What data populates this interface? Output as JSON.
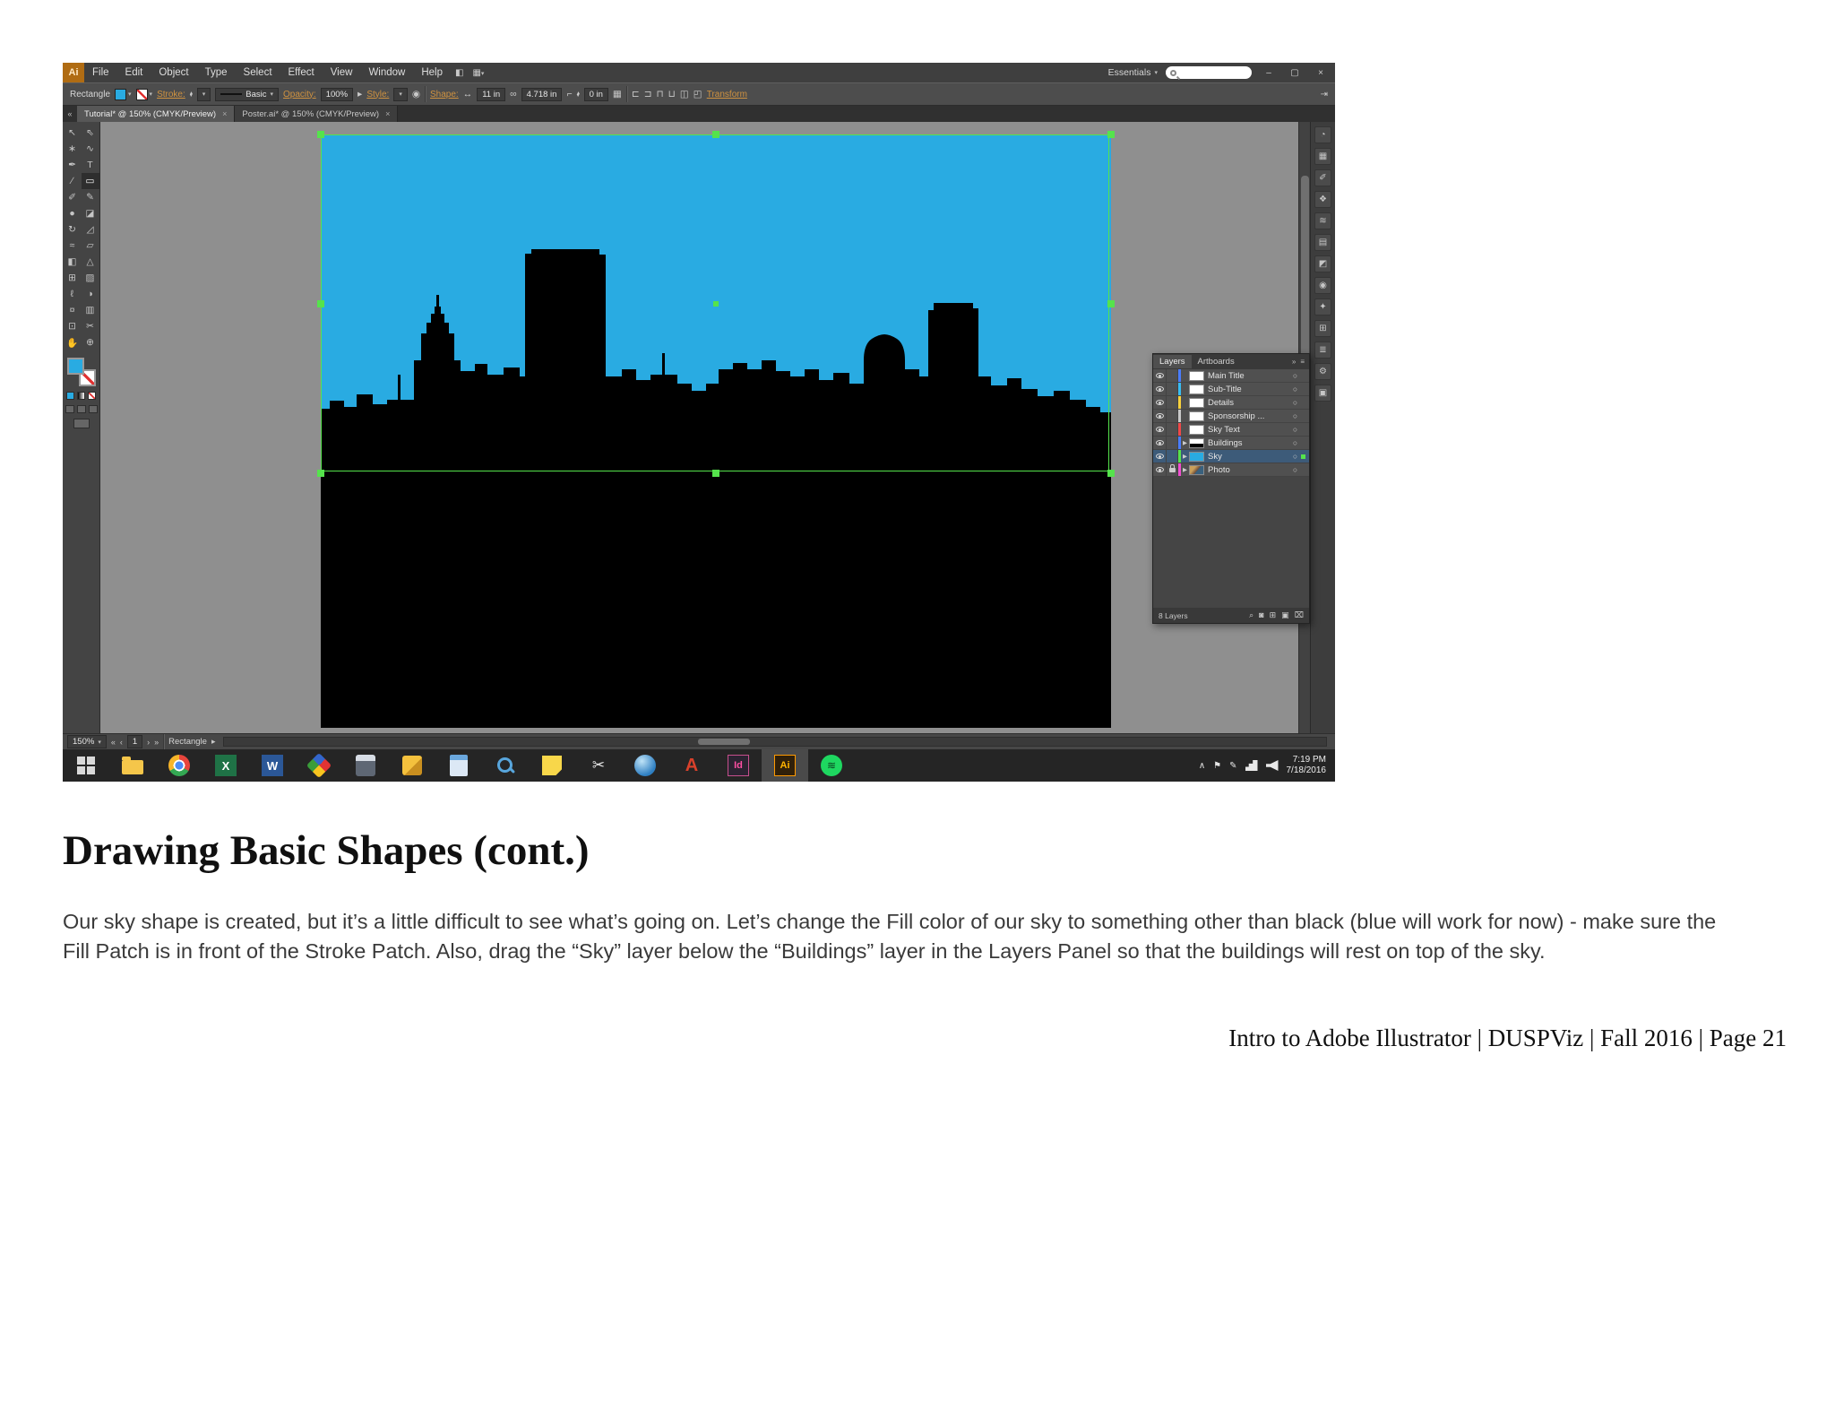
{
  "window": {
    "logo_text": "Ai",
    "menu_items": [
      "File",
      "Edit",
      "Object",
      "Type",
      "Select",
      "Effect",
      "View",
      "Window",
      "Help"
    ],
    "workspace_label": "Essentials"
  },
  "icons": {
    "dropdown": "▾",
    "side_arrow": "▸",
    "expand": "▶",
    "collapse": "«",
    "double_arrow": "»",
    "panel_menu": "≡",
    "close": "×",
    "minimize": "–",
    "restore": "▢",
    "target": "○",
    "width": "↔",
    "height": "↕",
    "corner": "⌐",
    "link_dims": "∞",
    "recolor": "◉",
    "grid": "▦",
    "locate": "⌕",
    "make_mask": "◙",
    "new_sublayer": "⊞",
    "new_layer": "▣",
    "delete": "⌧",
    "nav_first": "«",
    "nav_prev": "‹",
    "nav_next": "›",
    "nav_last": "»",
    "tray_up": "∧",
    "flag": "⚑",
    "pen": "✎",
    "scissors": "✂",
    "spotify_wave": "≋",
    "bridge": "◧",
    "arrange": "▦",
    "align": [
      "⊏",
      "⊐",
      "⊓",
      "⊔",
      "◫",
      "◰"
    ]
  },
  "control_bar": {
    "tool_label": "Rectangle",
    "stroke_label": "Stroke:",
    "brush_name": "Basic",
    "opacity_label": "Opacity:",
    "opacity_value": "100%",
    "style_label": "Style:",
    "shape_label": "Shape:",
    "width_value": "11 in",
    "height_value": "4.718 in",
    "corner_value": "0 in",
    "transform_label": "Transform"
  },
  "tabs": [
    {
      "label": "Tutorial* @ 150% (CMYK/Preview)"
    },
    {
      "label": "Poster.ai* @ 150% (CMYK/Preview)"
    }
  ],
  "tools": [
    {
      "name": "selection-tool",
      "glyph": "↖"
    },
    {
      "name": "direct-selection-tool",
      "glyph": "⇖"
    },
    {
      "name": "magic-wand-tool",
      "glyph": "∗"
    },
    {
      "name": "lasso-tool",
      "glyph": "∿"
    },
    {
      "name": "pen-tool",
      "glyph": "✒"
    },
    {
      "name": "type-tool",
      "glyph": "T"
    },
    {
      "name": "line-tool",
      "glyph": "∕"
    },
    {
      "name": "rectangle-tool",
      "glyph": "▭"
    },
    {
      "name": "paintbrush-tool",
      "glyph": "✐"
    },
    {
      "name": "pencil-tool",
      "glyph": "✎"
    },
    {
      "name": "blob-brush-tool",
      "glyph": "●"
    },
    {
      "name": "eraser-tool",
      "glyph": "◪"
    },
    {
      "name": "rotate-tool",
      "glyph": "↻"
    },
    {
      "name": "scale-tool",
      "glyph": "◿"
    },
    {
      "name": "width-tool",
      "glyph": "≈"
    },
    {
      "name": "free-transform-tool",
      "glyph": "▱"
    },
    {
      "name": "shape-builder-tool",
      "glyph": "◧"
    },
    {
      "name": "perspective-grid-tool",
      "glyph": "△"
    },
    {
      "name": "mesh-tool",
      "glyph": "⊞"
    },
    {
      "name": "gradient-tool",
      "glyph": "▨"
    },
    {
      "name": "eyedropper-tool",
      "glyph": "ℓ"
    },
    {
      "name": "blend-tool",
      "glyph": "◑"
    },
    {
      "name": "symbol-sprayer-tool",
      "glyph": "¤"
    },
    {
      "name": "column-graph-tool",
      "glyph": "▥"
    },
    {
      "name": "artboard-tool",
      "glyph": "⊡"
    },
    {
      "name": "slice-tool",
      "glyph": "✂"
    },
    {
      "name": "hand-tool",
      "glyph": "✋"
    },
    {
      "name": "zoom-tool",
      "glyph": "⊕"
    }
  ],
  "dock_icons": [
    "◔",
    "▦",
    "✐",
    "❖",
    "≋",
    "▤",
    "◩",
    "◉",
    "✦",
    "⊞",
    "≣",
    "⚙",
    "▣"
  ],
  "canvas": {
    "sky_color": "#29abe2",
    "building_color": "#000000",
    "selection_color": "#55e34c",
    "background": "#8f8f8f"
  },
  "layers_panel": {
    "tab_layers": "Layers",
    "tab_artboards": "Artboards",
    "layers": [
      {
        "name": "Main Title",
        "color": "#4a7dff"
      },
      {
        "name": "Sub-Title",
        "color": "#38bdf2"
      },
      {
        "name": "Details",
        "color": "#f7d13d"
      },
      {
        "name": "Sponsorship ...",
        "color": "#c9c9c9"
      },
      {
        "name": "Sky Text",
        "color": "#f04848"
      },
      {
        "name": "Buildings",
        "color": "#4a7dff"
      },
      {
        "name": "Sky",
        "color": "#55e34c"
      },
      {
        "name": "Photo",
        "color": "#f04fd0"
      }
    ],
    "status": "8 Layers"
  },
  "status_bar": {
    "zoom": "150%",
    "artboard_number": "1",
    "status_text": "Rectangle"
  },
  "taskbar": {
    "time": "7:19 PM",
    "date": "7/18/2016",
    "excel_letter": "X",
    "word_letter": "W",
    "autodesk_letter": "A",
    "indesign_label": "Id",
    "illustrator_label": "Ai"
  },
  "page": {
    "heading": "Drawing Basic Shapes (cont.)",
    "body": "Our sky shape is created, but it’s a little difficult to see what’s going on. Let’s change the Fill color of our sky to something other than black (blue will work for now) - make sure the Fill Patch is in front of the Stroke Patch. Also, drag the “Sky” layer below the “Buildings” layer in the Layers Panel so that the buildings will rest on top of the sky.",
    "footer": "Intro to Adobe Illustrator | DUSPViz | Fall 2016 | Page 21"
  }
}
